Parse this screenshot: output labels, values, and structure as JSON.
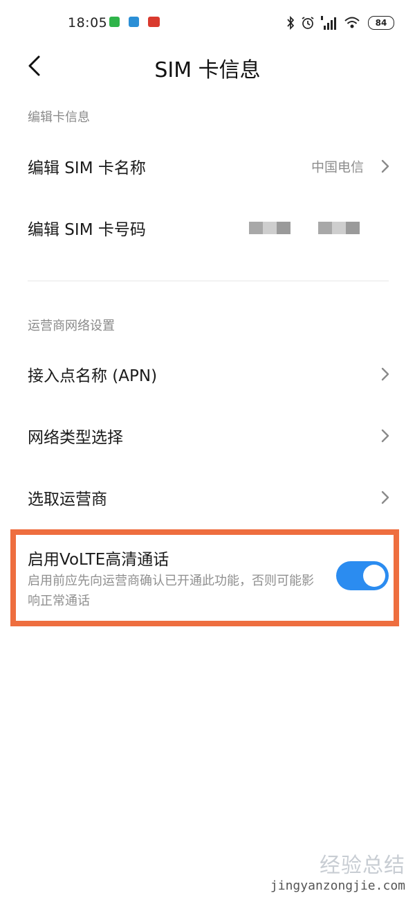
{
  "status_bar": {
    "time": "18:05",
    "battery": "84"
  },
  "header": {
    "title": "SIM 卡信息"
  },
  "sections": {
    "card_info": {
      "header": "编辑卡信息",
      "name_row": {
        "label": "编辑 SIM 卡名称",
        "value": "中国电信"
      },
      "number_row": {
        "label": "编辑 SIM 卡号码"
      }
    },
    "network": {
      "header": "运营商网络设置",
      "apn_label": "接入点名称 (APN)",
      "network_type_label": "网络类型选择",
      "operator_label": "选取运营商",
      "volte": {
        "title": "启用VoLTE高清通话",
        "description": "启用前应先向运营商确认已开通此功能，否则可能影响正常通话",
        "enabled": true
      }
    }
  },
  "colors": {
    "accent": "#2b8cf0",
    "highlight": "#ee6e3f"
  },
  "watermark": {
    "main": "经验总结",
    "sub": "jingyanzongjie.com"
  }
}
